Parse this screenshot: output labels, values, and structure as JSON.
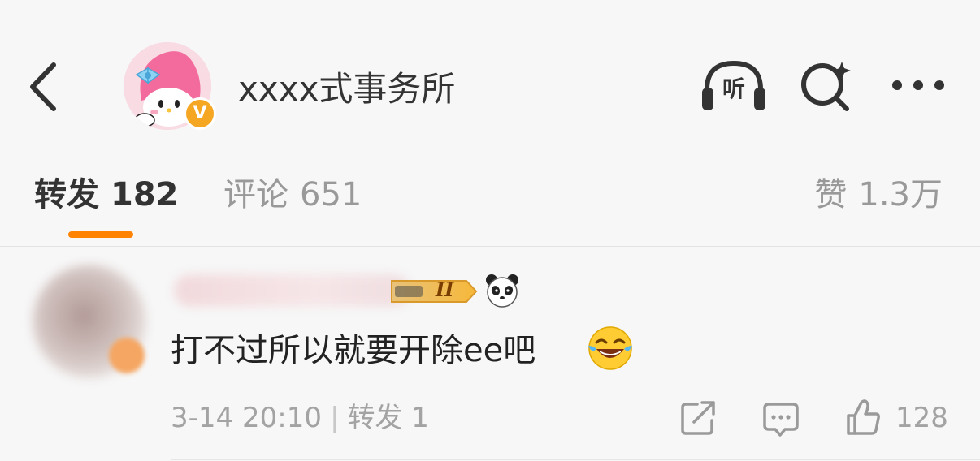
{
  "header": {
    "title": "xxxx式事务所",
    "back_icon": "chevron-left-icon",
    "verified_badge": "V",
    "listen_label": "听",
    "search_icon": "search-sparkle-icon",
    "more_icon": "more-dots-icon"
  },
  "tabs": {
    "forward": {
      "label": "转发",
      "count": "182"
    },
    "comment": {
      "label": "评论",
      "count": "651"
    },
    "like": {
      "label": "赞",
      "count": "1.3万"
    },
    "active": "forward",
    "accent_color": "#ff8200"
  },
  "repost": {
    "level_badge": "II",
    "text": "打不过所以就要开除ee吧",
    "time": "3-14 20:10",
    "separator": "|",
    "forward_label": "转发 1",
    "like_count": "128",
    "emoji_icons": [
      "panda-icon",
      "laughing-crying-icon"
    ]
  }
}
